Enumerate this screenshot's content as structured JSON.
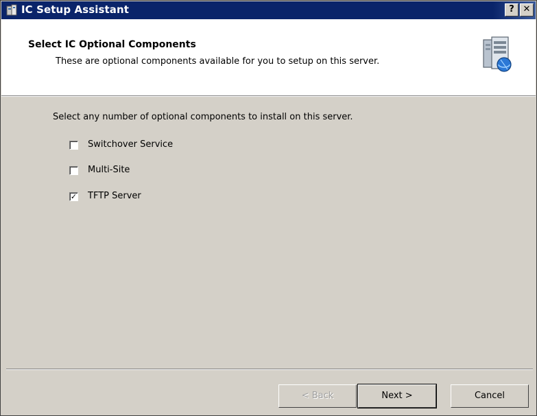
{
  "window": {
    "title": "IC Setup Assistant",
    "help_label": "?",
    "close_label": "✕",
    "app_icon": "setup-app-icon"
  },
  "header": {
    "title": "Select IC Optional Components",
    "subtitle": "These are optional components available for you to setup on this server.",
    "icon": "server-setup-icon"
  },
  "content": {
    "instruction": "Select any number of optional components to install on this server.",
    "options": [
      {
        "label": "Switchover Service",
        "checked": false
      },
      {
        "label": "Multi-Site",
        "checked": false
      },
      {
        "label": "TFTP Server",
        "checked": true
      }
    ]
  },
  "footer": {
    "back_label": "< Back",
    "next_label": "Next >",
    "cancel_label": "Cancel"
  },
  "colors": {
    "titlebar": "#0a246a",
    "dialog_face": "#d4d0c8",
    "header_background": "#ffffff"
  }
}
